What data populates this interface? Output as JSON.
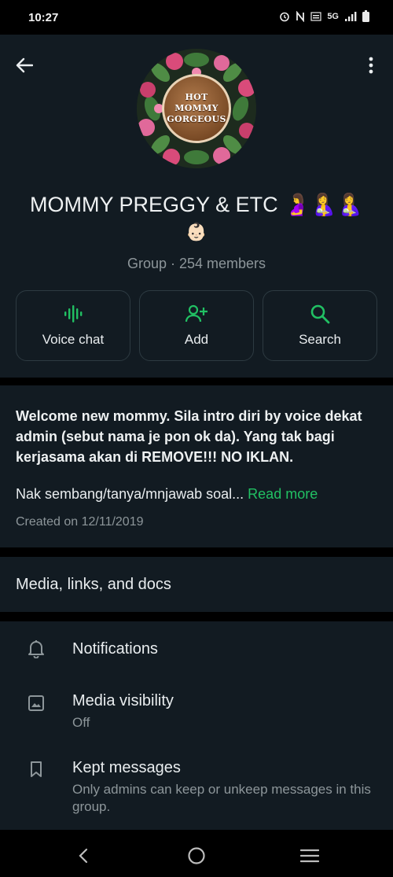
{
  "status_bar": {
    "time": "10:27",
    "network": "5G",
    "icons": [
      "alarm-icon",
      "nfc-icon",
      "volte-icon",
      "signal-icon",
      "battery-icon"
    ]
  },
  "header": {
    "avatar_text": [
      "HOT",
      "MOMMY",
      "GORGEOUS"
    ],
    "title": "MOMMY PREGGY & ETC 🤰🤱🤱",
    "title_emoji_line": "👶🏻",
    "subtitle": "Group · 254 members"
  },
  "actions": [
    {
      "label": "Voice chat",
      "icon": "voice-waveform-icon"
    },
    {
      "label": "Add",
      "icon": "add-person-icon"
    },
    {
      "label": "Search",
      "icon": "search-icon"
    }
  ],
  "description": {
    "bold_text": "Welcome new mommy. Sila intro diri by voice dekat admin (sebut nama je pon ok da). Yang tak bagi kerjasama akan di REMOVE!!! NO IKLAN.",
    "preview_text": "Nak sembang/tanya/mnjawab soal...",
    "read_more": "Read more",
    "created": "Created on 12/11/2019"
  },
  "media": {
    "label": "Media, links, and docs"
  },
  "settings": [
    {
      "title": "Notifications",
      "icon": "bell-icon"
    },
    {
      "title": "Media visibility",
      "subtitle": "Off",
      "icon": "image-icon"
    },
    {
      "title": "Kept messages",
      "subtitle": "Only admins can keep or unkeep messages in this group.",
      "icon": "bookmark-icon"
    }
  ],
  "colors": {
    "accent": "#21c063",
    "background": "#121b22",
    "text_secondary": "#8d969a"
  }
}
